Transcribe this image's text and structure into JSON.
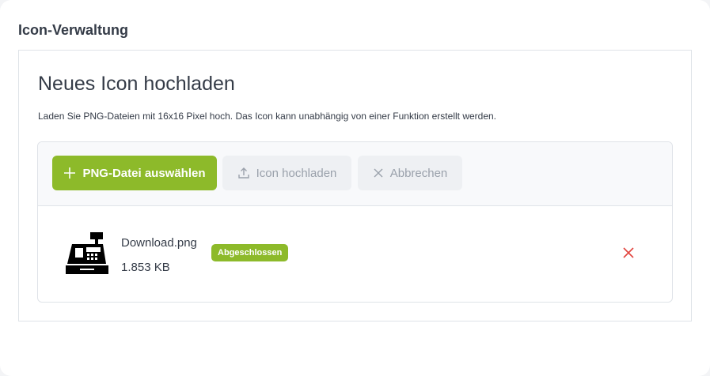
{
  "section": {
    "title": "Icon-Verwaltung"
  },
  "panel": {
    "heading": "Neues Icon hochladen",
    "description": "Laden Sie PNG-Dateien mit 16x16 Pixel hoch. Das Icon kann unabhängig von einer Funktion erstellt werden."
  },
  "toolbar": {
    "select_label": "PNG-Datei auswählen",
    "select_icon": "plus-icon",
    "upload_label": "Icon hochladen",
    "upload_icon": "upload-icon",
    "cancel_label": "Abbrechen",
    "cancel_icon": "close-icon"
  },
  "file": {
    "name": "Download.png",
    "size": "1.853 KB",
    "status": "Abgeschlossen",
    "thumbnail_icon": "cash-register-icon",
    "remove_icon": "close-icon"
  },
  "colors": {
    "accent": "#8dba2a",
    "text": "#343b47",
    "disabled_text": "#9aa1ab",
    "danger": "#e2443e"
  }
}
